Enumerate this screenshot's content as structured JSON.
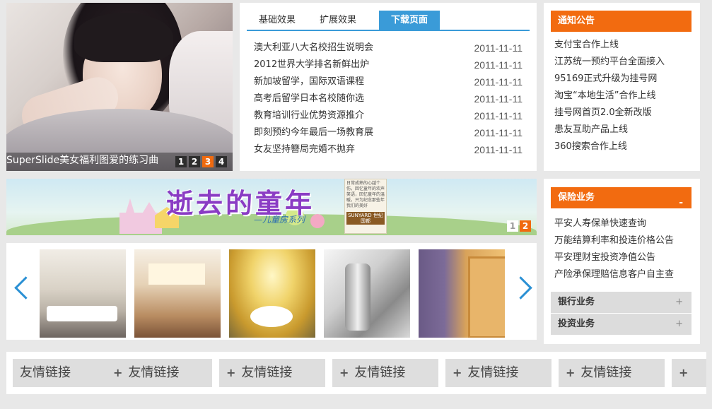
{
  "slideshow": {
    "caption": "SuperSlide美女福利图爱的练习曲",
    "pages": [
      "1",
      "2",
      "3",
      "4"
    ],
    "active_page": "3"
  },
  "tabs": {
    "items": [
      "基础效果",
      "扩展效果",
      "下载页面"
    ],
    "active": "下载页面"
  },
  "news": [
    {
      "title": "澳大利亚八大名校招生说明会",
      "date": "2011-11-11"
    },
    {
      "title": "2012世界大学排名新鲜出炉",
      "date": "2011-11-11"
    },
    {
      "title": "新加坡留学，国际双语课程",
      "date": "2011-11-11"
    },
    {
      "title": "高考后留学日本名校随你选",
      "date": "2011-11-11"
    },
    {
      "title": "教育培训行业优势资源推介",
      "date": "2011-11-11"
    },
    {
      "title": "即刻预约今年最后一场教育展",
      "date": "2011-11-11"
    },
    {
      "title": "女友坚持簪局完婚不抛弃",
      "date": "2011-11-11"
    }
  ],
  "notice": {
    "title": "通知公告",
    "items": [
      "支付宝合作上线",
      "江苏统一预约平台全面接入",
      "95169正式升级为挂号网",
      "淘宝“本地生活”合作上线",
      "挂号网首页2.0全新改版",
      "患友互助产品上线",
      "360搜索合作上线"
    ]
  },
  "banner": {
    "title": "逝去的童年",
    "subtitle": "—儿童房系列",
    "ad_text": "日常成熟的心越个伤，回忆童年的欢声笑语，回忆童年的温暖，只为纪念那些年我们的美好",
    "ad_logo": "SUNYARD 世纪国都",
    "pages": [
      "1",
      "2"
    ],
    "active_page": "2"
  },
  "thumbs": [
    "living-room",
    "bedroom-tv-wall",
    "warm-lit-room",
    "chrome-faucet",
    "kids-desk-shelf"
  ],
  "insurance": {
    "title": "保险业务",
    "toggle": "-",
    "items": [
      "平安人寿保单快速查询",
      "万能结算利率和投连价格公告",
      "平安理财宝投资净值公告",
      "产险承保理赔信息客户自主查"
    ],
    "sections": [
      {
        "label": "银行业务",
        "toggle": "+"
      },
      {
        "label": "投资业务",
        "toggle": "+"
      }
    ]
  },
  "footer": {
    "links": [
      "友情链接",
      "友情链接",
      "友情链接",
      "友情链接",
      "友情链接",
      "友情链接"
    ],
    "plus": "+"
  }
}
